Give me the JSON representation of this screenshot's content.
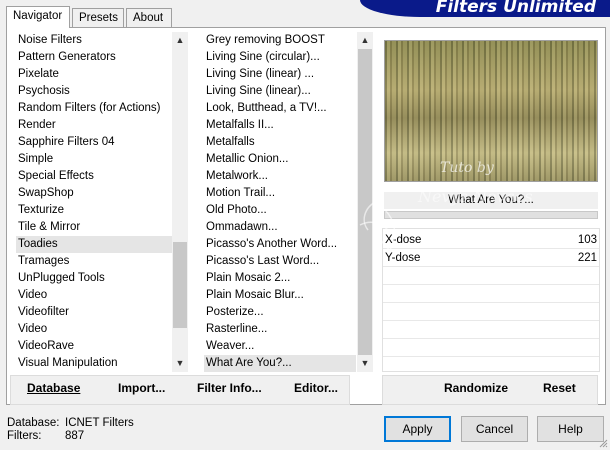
{
  "banner": {
    "title": "Filters Unlimited"
  },
  "tabs": [
    {
      "label": "Navigator",
      "active": true
    },
    {
      "label": "Presets",
      "active": false
    },
    {
      "label": "About",
      "active": false
    }
  ],
  "categories": {
    "items": [
      "Noise Filters",
      "Pattern Generators",
      "Pixelate",
      "Psychosis",
      "Random Filters (for Actions)",
      "Render",
      "Sapphire Filters 04",
      "Simple",
      "Special Effects",
      "SwapShop",
      "Texturize",
      "Tile & Mirror",
      "Toadies",
      "Tramages",
      "UnPlugged Tools",
      "Video",
      "Videofilter",
      "Video",
      "VideoRave",
      "Visual Manipulation"
    ],
    "selected_index": 12
  },
  "filters": {
    "items": [
      "Grey removing BOOST",
      "Living Sine (circular)...",
      "Living Sine (linear) ...",
      "Living Sine (linear)...",
      "Look, Butthead, a TV!...",
      "Metalfalls II...",
      "Metalfalls",
      "Metallic Onion...",
      "Metalwork...",
      "Motion Trail...",
      "Old Photo...",
      "Ommadawn...",
      "Picasso's Another Word...",
      "Picasso's Last Word...",
      "Plain Mosaic 2...",
      "Plain Mosaic Blur...",
      "Posterize...",
      "Rasterline...",
      "Weaver...",
      "What Are You?..."
    ],
    "selected_index": 19
  },
  "preview": {
    "watermark_line1": "Tuto by",
    "watermark_line2": "Nevys Novaes"
  },
  "filter_panel": {
    "current_filter": "What Are You?...",
    "params": [
      {
        "name": "X-dose",
        "value": "103"
      },
      {
        "name": "Y-dose",
        "value": "221"
      }
    ]
  },
  "toolbar": {
    "database_label": "Database",
    "import_label": "Import...",
    "filter_info_label": "Filter Info...",
    "editor_label": "Editor...",
    "randomize_label": "Randomize",
    "reset_label": "Reset"
  },
  "status": {
    "database_label": "Database:",
    "database_value": "ICNET Filters",
    "filters_label": "Filters:",
    "filters_value": "887"
  },
  "dialog_buttons": {
    "apply": "Apply",
    "cancel": "Cancel",
    "help": "Help"
  },
  "colors": {
    "banner_bg": "#0a1a8a",
    "default_button_border": "#0078d7",
    "selection_bg": "#e5e5e5"
  }
}
